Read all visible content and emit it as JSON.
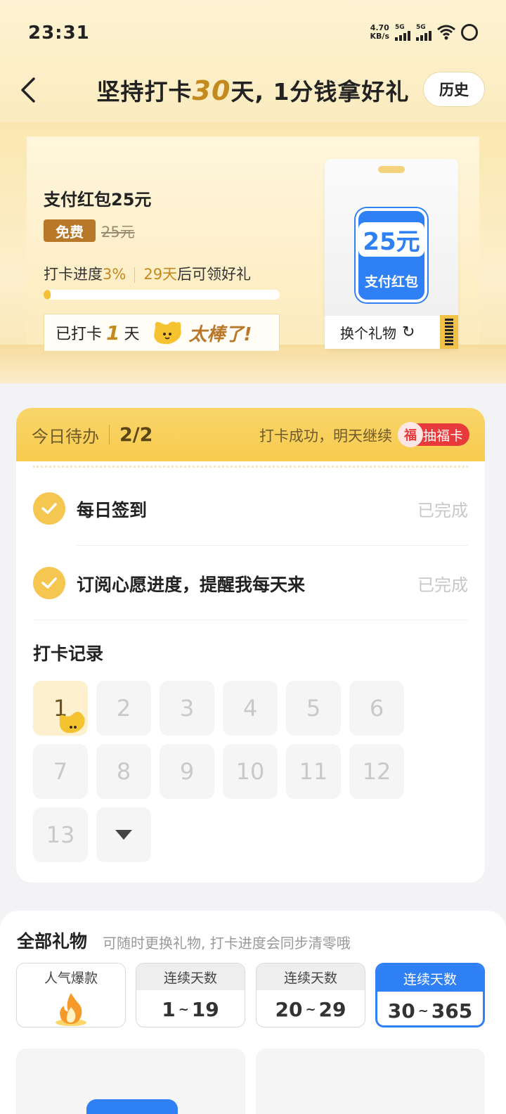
{
  "status": {
    "time": "23:31",
    "net_speed_value": "4.70",
    "net_speed_unit": "KB/s",
    "sim1": "5G",
    "sim2": "5G"
  },
  "nav": {
    "title_pre": "坚持打卡",
    "title_num": "30",
    "title_post": "天, 1分钱拿好礼",
    "history": "历史"
  },
  "prize": {
    "name": "支付红包25元",
    "free_tag": "免费",
    "original_price": "25元",
    "progress_label": "打卡进度",
    "progress_pct": "3%",
    "days_left": "29天",
    "days_left_suffix": "后可领好礼",
    "progress_fraction": 0.03,
    "checked_pre": "已打卡",
    "checked_days": "1",
    "checked_post": "天",
    "cheer": "太棒了!",
    "card_amount": "25元",
    "card_kind": "支付红包",
    "swap": "换个礼物",
    "refresh_glyph": "↻"
  },
  "tasks": {
    "header_label": "今日待办",
    "count": "2/2",
    "message": "打卡成功，明天继续",
    "lucky_coin": "福",
    "lucky_label": "抽福卡",
    "items": [
      {
        "name": "每日签到",
        "status": "已完成"
      },
      {
        "name": "订阅心愿进度，提醒我每天来",
        "status": "已完成"
      }
    ],
    "record_title": "打卡记录",
    "days": [
      "1",
      "2",
      "3",
      "4",
      "5",
      "6",
      "7",
      "8",
      "9",
      "10",
      "11",
      "12",
      "13"
    ]
  },
  "gifts": {
    "title": "全部礼物",
    "subtitle": "可随时更换礼物, 打卡进度会同步清零哦",
    "tabs": [
      {
        "head": "人气爆款"
      },
      {
        "head": "连续天数",
        "from": "1",
        "to": "19"
      },
      {
        "head": "连续天数",
        "from": "20",
        "to": "29"
      },
      {
        "head": "连续天数",
        "from": "30",
        "to": "365"
      }
    ],
    "tilde": "~"
  },
  "colors": {
    "accent_gold": "#c48a1f",
    "accent_blue": "#2f7ff5",
    "lucky_red": "#e83a3a"
  }
}
